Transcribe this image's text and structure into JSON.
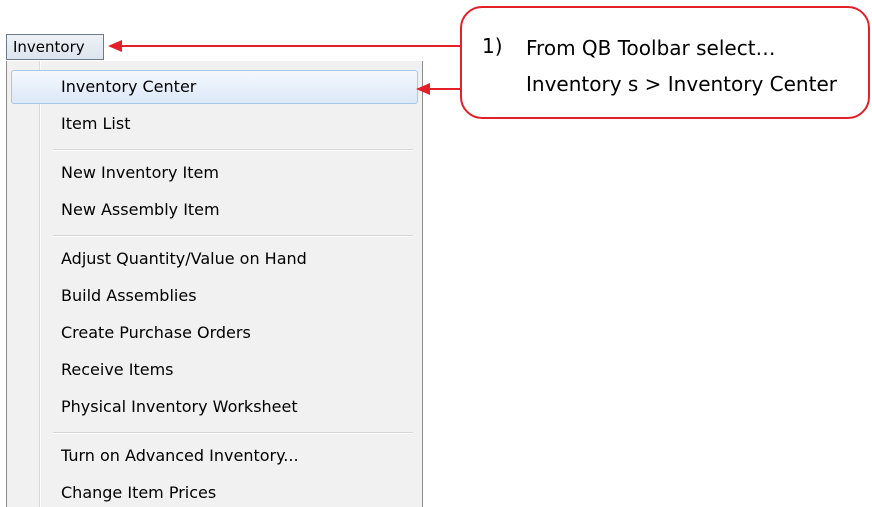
{
  "menu_button": {
    "label": "Inventory"
  },
  "dropdown": {
    "groups": [
      [
        "Inventory Center",
        "Item List"
      ],
      [
        "New Inventory Item",
        "New Assembly Item"
      ],
      [
        "Adjust Quantity/Value on Hand",
        "Build Assemblies",
        "Create Purchase Orders",
        "Receive Items",
        "Physical Inventory Worksheet"
      ],
      [
        "Turn on Advanced Inventory...",
        "Change Item Prices"
      ]
    ],
    "highlighted": "Inventory Center"
  },
  "callout": {
    "number": "1)",
    "line1": "From QB Toolbar select…",
    "line2": "Inventory s > Inventory Center"
  },
  "colors": {
    "accent": "#e3202a",
    "highlight": "#dce9f8"
  }
}
